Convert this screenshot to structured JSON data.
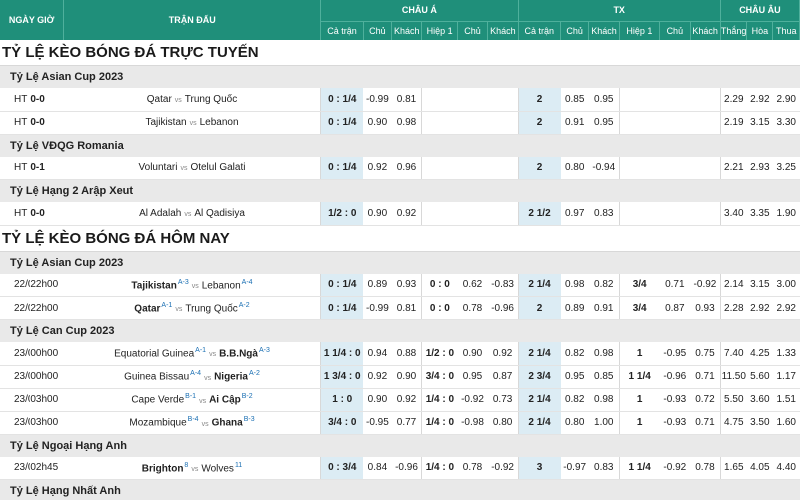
{
  "header": {
    "time_col": "NGÀY GIỜ",
    "match_col": "TRẬN ĐẤU",
    "asia": "CHÂU Á",
    "tx": "TX",
    "europe": "CHÂU ÂU",
    "sub": [
      "Cả trận",
      "Chủ",
      "Khách",
      "Hiệp 1",
      "Chủ",
      "Khách",
      "Cả trận",
      "Chủ",
      "Khách",
      "Hiệp 1",
      "Chủ",
      "Khách",
      "Thắng",
      "Hòa",
      "Thua"
    ]
  },
  "sections": [
    {
      "title": "TỶ LỆ KÈO BÓNG ĐÁ TRỰC TUYẾN",
      "leagues": [
        {
          "name": "Tỷ Lệ Asian Cup 2023",
          "matches": [
            {
              "t1": "HT",
              "t2": "0-0",
              "home": "Qatar",
              "away": "Trung Quốc",
              "hr": "",
              "ar": "",
              "hb": false,
              "ab": false,
              "a_ft": "0 : 1/4",
              "a_h": "-0.99",
              "a_a": "0.81",
              "a_h1": "",
              "a_h1h": "",
              "a_h1a": "",
              "t_ft": "2",
              "t_h": "0.85",
              "t_a": "0.95",
              "t_h1": "",
              "t_h1h": "",
              "t_h1a": "",
              "w": "2.29",
              "d": "2.92",
              "l": "2.90"
            },
            {
              "t1": "HT",
              "t2": "0-0",
              "home": "Tajikistan",
              "away": "Lebanon",
              "hr": "",
              "ar": "",
              "hb": false,
              "ab": false,
              "a_ft": "0 : 1/4",
              "a_h": "0.90",
              "a_a": "0.98",
              "a_h1": "",
              "a_h1h": "",
              "a_h1a": "",
              "t_ft": "2",
              "t_h": "0.91",
              "t_a": "0.95",
              "t_h1": "",
              "t_h1h": "",
              "t_h1a": "",
              "w": "2.19",
              "d": "3.15",
              "l": "3.30"
            }
          ]
        },
        {
          "name": "Tỷ Lệ VĐQG Romania",
          "matches": [
            {
              "t1": "HT",
              "t2": "0-1",
              "home": "Voluntari",
              "away": "Otelul Galati",
              "hr": "",
              "ar": "",
              "hb": false,
              "ab": false,
              "a_ft": "0 : 1/4",
              "a_h": "0.92",
              "a_a": "0.96",
              "a_h1": "",
              "a_h1h": "",
              "a_h1a": "",
              "t_ft": "2",
              "t_h": "0.80",
              "t_a": "-0.94",
              "t_h1": "",
              "t_h1h": "",
              "t_h1a": "",
              "w": "2.21",
              "d": "2.93",
              "l": "3.25"
            }
          ]
        },
        {
          "name": "Tỷ Lệ Hạng 2 Arập Xeut",
          "matches": [
            {
              "t1": "HT",
              "t2": "0-0",
              "home": "Al Adalah",
              "away": "Al Qadisiya",
              "hr": "",
              "ar": "",
              "hb": false,
              "ab": false,
              "a_ft": "1/2 : 0",
              "a_h": "0.90",
              "a_a": "0.92",
              "a_h1": "",
              "a_h1h": "",
              "a_h1a": "",
              "t_ft": "2 1/2",
              "t_h": "0.97",
              "t_a": "0.83",
              "t_h1": "",
              "t_h1h": "",
              "t_h1a": "",
              "w": "3.40",
              "d": "3.35",
              "l": "1.90"
            }
          ]
        }
      ]
    },
    {
      "title": "TỶ LỆ KÈO BÓNG ĐÁ HÔM NAY",
      "leagues": [
        {
          "name": "Tỷ Lệ Asian Cup 2023",
          "matches": [
            {
              "t1": "22/01",
              "t2": "22h00",
              "home": "Tajikistan",
              "away": "Lebanon",
              "hr": "A-3",
              "ar": "A-4",
              "hb": true,
              "ab": false,
              "a_ft": "0 : 1/4",
              "a_h": "0.89",
              "a_a": "0.93",
              "a_h1": "0 : 0",
              "a_h1h": "0.62",
              "a_h1a": "-0.83",
              "t_ft": "2 1/4",
              "t_h": "0.98",
              "t_a": "0.82",
              "t_h1": "3/4",
              "t_h1h": "0.71",
              "t_h1a": "-0.92",
              "w": "2.14",
              "d": "3.15",
              "l": "3.00"
            },
            {
              "t1": "22/01",
              "t2": "22h00",
              "home": "Qatar",
              "away": "Trung Quốc",
              "hr": "A-1",
              "ar": "A-2",
              "hb": true,
              "ab": false,
              "a_ft": "0 : 1/4",
              "a_h": "-0.99",
              "a_a": "0.81",
              "a_h1": "0 : 0",
              "a_h1h": "0.78",
              "a_h1a": "-0.96",
              "t_ft": "2",
              "t_h": "0.89",
              "t_a": "0.91",
              "t_h1": "3/4",
              "t_h1h": "0.87",
              "t_h1a": "0.93",
              "w": "2.28",
              "d": "2.92",
              "l": "2.92"
            }
          ]
        },
        {
          "name": "Tỷ Lệ Can Cup 2023",
          "matches": [
            {
              "t1": "23/01",
              "t2": "00h00",
              "home": "Equatorial Guinea",
              "away": "B.B.Ngà",
              "hr": "A-1",
              "ar": "A-3",
              "hb": false,
              "ab": true,
              "a_ft": "1 1/4 : 0",
              "a_h": "0.94",
              "a_a": "0.88",
              "a_h1": "1/2 : 0",
              "a_h1h": "0.90",
              "a_h1a": "0.92",
              "t_ft": "2 1/4",
              "t_h": "0.82",
              "t_a": "0.98",
              "t_h1": "1",
              "t_h1h": "-0.95",
              "t_h1a": "0.75",
              "w": "7.40",
              "d": "4.25",
              "l": "1.33"
            },
            {
              "t1": "23/01",
              "t2": "00h00",
              "home": "Guinea Bissau",
              "away": "Nigeria",
              "hr": "A-4",
              "ar": "A-2",
              "hb": false,
              "ab": true,
              "a_ft": "1 3/4 : 0",
              "a_h": "0.92",
              "a_a": "0.90",
              "a_h1": "3/4 : 0",
              "a_h1h": "0.95",
              "a_h1a": "0.87",
              "t_ft": "2 3/4",
              "t_h": "0.95",
              "t_a": "0.85",
              "t_h1": "1 1/4",
              "t_h1h": "-0.96",
              "t_h1a": "0.71",
              "w": "11.50",
              "d": "5.60",
              "l": "1.17"
            },
            {
              "t1": "23/01",
              "t2": "03h00",
              "home": "Cape Verde",
              "away": "Ai Cập",
              "hr": "B-1",
              "ar": "B-2",
              "hb": false,
              "ab": true,
              "a_ft": "1 : 0",
              "a_h": "0.90",
              "a_a": "0.92",
              "a_h1": "1/4 : 0",
              "a_h1h": "-0.92",
              "a_h1a": "0.73",
              "t_ft": "2 1/4",
              "t_h": "0.82",
              "t_a": "0.98",
              "t_h1": "1",
              "t_h1h": "-0.93",
              "t_h1a": "0.72",
              "w": "5.50",
              "d": "3.60",
              "l": "1.51"
            },
            {
              "t1": "23/01",
              "t2": "03h00",
              "home": "Mozambique",
              "away": "Ghana",
              "hr": "B-4",
              "ar": "B-3",
              "hb": false,
              "ab": true,
              "a_ft": "3/4 : 0",
              "a_h": "-0.95",
              "a_a": "0.77",
              "a_h1": "1/4 : 0",
              "a_h1h": "-0.98",
              "a_h1a": "0.80",
              "t_ft": "2 1/4",
              "t_h": "0.80",
              "t_a": "1.00",
              "t_h1": "1",
              "t_h1h": "-0.93",
              "t_h1a": "0.71",
              "w": "4.75",
              "d": "3.50",
              "l": "1.60"
            }
          ]
        },
        {
          "name": "Tỷ Lệ Ngoại Hạng Anh",
          "matches": [
            {
              "t1": "23/01",
              "t2": "02h45",
              "home": "Brighton",
              "away": "Wolves",
              "hr": "8",
              "ar": "11",
              "hb": true,
              "ab": false,
              "a_ft": "0 : 3/4",
              "a_h": "0.84",
              "a_a": "-0.96",
              "a_h1": "1/4 : 0",
              "a_h1h": "0.78",
              "a_h1a": "-0.92",
              "t_ft": "3",
              "t_h": "-0.97",
              "t_a": "0.83",
              "t_h1": "1 1/4",
              "t_h1h": "-0.92",
              "t_h1a": "0.78",
              "w": "1.65",
              "d": "4.05",
              "l": "4.40"
            }
          ]
        },
        {
          "name": "Tỷ Lệ Hạng Nhất Anh",
          "matches": []
        }
      ]
    }
  ]
}
